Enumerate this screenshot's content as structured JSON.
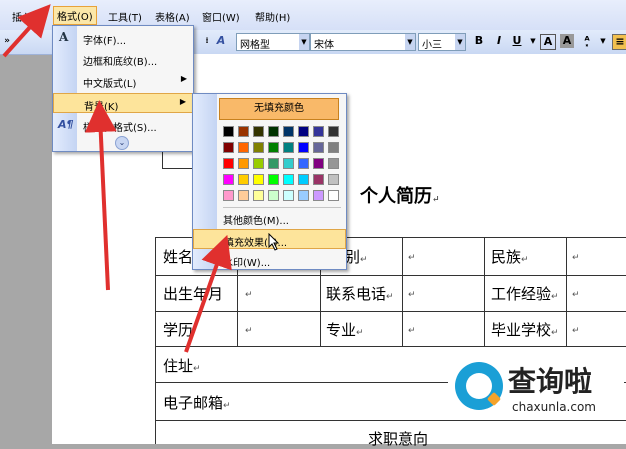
{
  "menubar": {
    "items": [
      "插入(I)",
      "格式(O)",
      "工具(T)",
      "表格(A)",
      "窗口(W)",
      "帮助(H)"
    ]
  },
  "toolbar": {
    "style": "网格型",
    "font": "宋体",
    "size": "小三",
    "bold": "B",
    "italic": "I",
    "underline": "U",
    "font_color": "A",
    "char_shade": "A"
  },
  "format_menu": {
    "items": [
      "字体(F)...",
      "边框和底纹(B)...",
      "中文版式(L)",
      "背景(K)",
      "样式和格式(S)..."
    ]
  },
  "background_menu": {
    "no_fill": "无填充颜色",
    "palette": [
      [
        "#000000",
        "#993300",
        "#333300",
        "#003300",
        "#003366",
        "#000080",
        "#333399",
        "#333333"
      ],
      [
        "#800000",
        "#FF6600",
        "#808000",
        "#008000",
        "#008080",
        "#0000FF",
        "#666699",
        "#808080"
      ],
      [
        "#FF0000",
        "#FF9900",
        "#99CC00",
        "#339966",
        "#33CCCC",
        "#3366FF",
        "#800080",
        "#969696"
      ],
      [
        "#FF00FF",
        "#FFCC00",
        "#FFFF00",
        "#00FF00",
        "#00FFFF",
        "#00CCFF",
        "#993366",
        "#C0C0C0"
      ],
      [
        "#FF99CC",
        "#FFCC99",
        "#FFFF99",
        "#CCFFCC",
        "#CCFFFF",
        "#99CCFF",
        "#CC99FF",
        "#FFFFFF"
      ]
    ],
    "more_colors": "其他颜色(M)...",
    "fill_effects": "填充效果(F)...",
    "watermark": "水印(W)..."
  },
  "document": {
    "title": "个人简历",
    "mark": "↵",
    "rows": [
      [
        "姓名",
        "别",
        "民族"
      ],
      [
        "出生年月",
        "联系电话",
        "工作经验"
      ],
      [
        "学历",
        "专业",
        "毕业学校"
      ],
      [
        "住址"
      ],
      [
        "电子邮箱"
      ],
      [
        "求职意向"
      ]
    ]
  },
  "watermark": {
    "name": "查询啦",
    "url": "chaxunla.com"
  },
  "colors": {
    "menu_highlight": "#fde49b",
    "no_fill_button": "#f9b969",
    "annotation_arrow": "#e0302e",
    "brand_blue": "#1a9fd6"
  }
}
